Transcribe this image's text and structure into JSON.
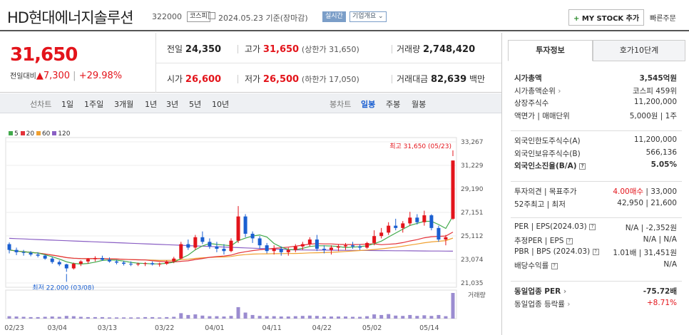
{
  "header": {
    "name": "HD현대에너지솔루션",
    "code": "322000",
    "market": "코스피",
    "date": "2024.05.23",
    "date_note": "기준(장마감)",
    "live_label": "실시간",
    "corp_label": "기업개요",
    "mystock_label": "MY STOCK 추가",
    "quick_label": "빠른주문"
  },
  "price": {
    "current": "31,650",
    "diff_label": "전일대비",
    "diff": "7,300",
    "rate": "+29.98%",
    "prev_label": "전일",
    "prev": "24,350",
    "high_label": "고가",
    "high": "31,650",
    "upper_label": "(상한가 31,650)",
    "volume_label": "거래량",
    "volume": "2,748,420",
    "open_label": "시가",
    "open": "26,600",
    "low_label": "저가",
    "low": "26,500",
    "lower_label": "(하한가 17,050)",
    "amount_label": "거래대금",
    "amount": "82,639",
    "amount_unit": "백만"
  },
  "periods": {
    "line_label": "선차트",
    "line_items": [
      "1일",
      "1주일",
      "3개월",
      "1년",
      "3년",
      "5년",
      "10년"
    ],
    "candle_label": "봉차트",
    "candle_items": [
      "일봉",
      "주봉",
      "월봉"
    ],
    "candle_active": "일봉"
  },
  "chart_data": {
    "type": "candlestick",
    "legend": [
      {
        "name": "5",
        "color": "#41a94b"
      },
      {
        "name": "20",
        "color": "#e3333a"
      },
      {
        "name": "60",
        "color": "#f0a030"
      },
      {
        "name": "120",
        "color": "#8a5fc4"
      }
    ],
    "y_ticks": [
      33267,
      31229,
      29190,
      27151,
      25112,
      23074,
      21035
    ],
    "ylim": [
      21035,
      33267
    ],
    "x_ticks": [
      "02/23",
      "03/04",
      "03/13",
      "03/22",
      "04/01",
      "04/11",
      "04/22",
      "05/02",
      "05/14"
    ],
    "max_annotation": "최고 31,650 (05/23)",
    "min_annotation": "최저 22,000 (03/08)",
    "volume_label": "거래량",
    "candles": [
      [
        24400,
        24550,
        23600,
        23900
      ],
      [
        23900,
        24100,
        23450,
        23700
      ],
      [
        23700,
        23900,
        23400,
        23650
      ],
      [
        23650,
        23800,
        23350,
        23500
      ],
      [
        23500,
        23700,
        23250,
        23400
      ],
      [
        23400,
        23500,
        23050,
        23150
      ],
      [
        23150,
        23300,
        22700,
        22850
      ],
      [
        22850,
        23000,
        22500,
        22650
      ],
      [
        22650,
        22700,
        22000,
        22300
      ],
      [
        22300,
        22800,
        22200,
        22700
      ],
      [
        22700,
        23000,
        22500,
        22900
      ],
      [
        22900,
        23200,
        22700,
        23100
      ],
      [
        23100,
        23350,
        22900,
        23200
      ],
      [
        23200,
        23400,
        22950,
        23050
      ],
      [
        23050,
        23250,
        22800,
        22900
      ],
      [
        22900,
        23050,
        22650,
        22800
      ],
      [
        22800,
        22950,
        22550,
        22700
      ],
      [
        22700,
        22900,
        22500,
        22650
      ],
      [
        22650,
        22800,
        22500,
        22700
      ],
      [
        22700,
        22850,
        22500,
        22750
      ],
      [
        22750,
        22900,
        22550,
        22650
      ],
      [
        22650,
        22800,
        22450,
        22700
      ],
      [
        22700,
        23000,
        22600,
        22900
      ],
      [
        22900,
        23300,
        22750,
        23150
      ],
      [
        23150,
        24600,
        23100,
        24400
      ],
      [
        24400,
        24800,
        23900,
        24100
      ],
      [
        24100,
        25200,
        23900,
        25000
      ],
      [
        25000,
        25500,
        24400,
        24600
      ],
      [
        24600,
        24900,
        24000,
        24200
      ],
      [
        24200,
        24600,
        23700,
        24000
      ],
      [
        24000,
        24400,
        23500,
        23800
      ],
      [
        23800,
        24900,
        23700,
        24700
      ],
      [
        24700,
        27700,
        24500,
        26800
      ],
      [
        26800,
        27000,
        25000,
        25300
      ],
      [
        25300,
        25500,
        24500,
        24900
      ],
      [
        24900,
        25100,
        24000,
        24300
      ],
      [
        24300,
        24500,
        23600,
        23800
      ],
      [
        23800,
        24300,
        23500,
        24000
      ],
      [
        24000,
        24200,
        23400,
        23700
      ],
      [
        23700,
        24100,
        23400,
        23900
      ],
      [
        23900,
        24400,
        23700,
        24200
      ],
      [
        24200,
        24600,
        23900,
        24400
      ],
      [
        24400,
        25000,
        24200,
        24800
      ],
      [
        24800,
        25200,
        23800,
        24000
      ],
      [
        24000,
        24300,
        23600,
        23900
      ],
      [
        23900,
        24300,
        23500,
        24100
      ],
      [
        24100,
        24400,
        23800,
        24200
      ],
      [
        24200,
        24500,
        23900,
        24300
      ],
      [
        24300,
        24600,
        24000,
        24200
      ],
      [
        24200,
        24400,
        23900,
        24100
      ],
      [
        24100,
        24600,
        24000,
        24500
      ],
      [
        24500,
        25600,
        24300,
        25100
      ],
      [
        25100,
        25800,
        24900,
        25400
      ],
      [
        25400,
        26300,
        25200,
        26000
      ],
      [
        26000,
        26600,
        25600,
        25800
      ],
      [
        25800,
        26400,
        25400,
        26200
      ],
      [
        26200,
        27200,
        26000,
        26700
      ],
      [
        26700,
        27000,
        26100,
        26300
      ],
      [
        26300,
        27300,
        26000,
        26900
      ],
      [
        26900,
        27000,
        25600,
        25800
      ],
      [
        25800,
        26000,
        24600,
        24800
      ],
      [
        24800,
        25200,
        24300,
        25000
      ],
      [
        26600,
        31650,
        26500,
        31650
      ]
    ],
    "volumes": [
      8,
      7,
      6,
      5,
      5,
      6,
      7,
      6,
      9,
      8,
      6,
      5,
      5,
      5,
      4,
      4,
      4,
      4,
      4,
      5,
      5,
      4,
      5,
      6,
      18,
      12,
      14,
      10,
      8,
      8,
      7,
      9,
      38,
      20,
      12,
      9,
      8,
      8,
      7,
      7,
      8,
      9,
      10,
      9,
      7,
      7,
      7,
      7,
      6,
      6,
      8,
      14,
      12,
      15,
      10,
      9,
      12,
      9,
      11,
      9,
      12,
      8,
      85
    ]
  },
  "side": {
    "tab_active": "투자정보",
    "tab_other": "호가10단계",
    "rows1": [
      {
        "l": "시가총액",
        "r": "3,545억원",
        "bold": true
      },
      {
        "l": "시가총액순위",
        "r": "코스피 459위"
      },
      {
        "l": "상장주식수",
        "r": "11,200,000"
      },
      {
        "l": "액면가 | 매매단위",
        "r": "5,000원 | 1주"
      }
    ],
    "rows2": [
      {
        "l": "외국인한도주식수(A)",
        "r": "11,200,000"
      },
      {
        "l": "외국인보유주식수(B)",
        "r": "566,136"
      },
      {
        "l": "외국인소진율(B/A)",
        "r": "5.05%",
        "bold": true
      }
    ],
    "rows3": [
      {
        "l": "투자의견 | 목표주가",
        "r_red": "4.00매수",
        "r": "33,000"
      },
      {
        "l": "52주최고 | 최저",
        "r": "42,950 | 21,600"
      }
    ],
    "rows4": [
      {
        "l": "PER | EPS(2024.03)",
        "r": "N/A | -2,352원"
      },
      {
        "l": "추정PER | EPS",
        "r": "N/A | N/A"
      },
      {
        "l": "PBR | BPS (2024.03)",
        "r": "1.01배 | 31,451원"
      },
      {
        "l": "배당수익률",
        "r": "N/A"
      }
    ],
    "rows5": [
      {
        "l": "동일업종 PER",
        "r": "-75.72배",
        "bold": true
      },
      {
        "l": "동일업종 등락률",
        "r": "+8.71%",
        "red": true
      }
    ]
  }
}
